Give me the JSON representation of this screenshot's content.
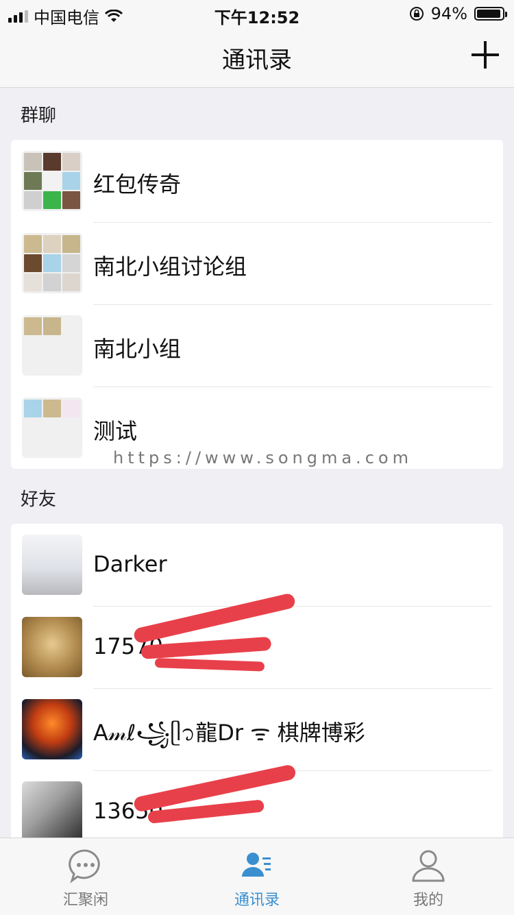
{
  "status_bar": {
    "carrier": "中国电信",
    "time": "下午12:52",
    "battery": "94%",
    "battery_level": 0.94
  },
  "nav": {
    "title": "通讯录"
  },
  "groups": {
    "header": "群聊",
    "items": [
      {
        "name": "红包传奇"
      },
      {
        "name": "南北小组讨论组"
      },
      {
        "name": "南北小组"
      },
      {
        "name": "测试"
      }
    ]
  },
  "watermark": "https://www.songma.com",
  "friends": {
    "header": "好友",
    "items": [
      {
        "name": "Darker"
      },
      {
        "name": "17570"
      },
      {
        "name": "A𝓂ℓ꧁ᥫ᭡龍Dr ᯤ  棋牌博彩"
      },
      {
        "name": "13650"
      }
    ]
  },
  "tabs": [
    {
      "label": "汇聚闲",
      "icon": "chat-bubble-icon",
      "active": false
    },
    {
      "label": "通讯录",
      "icon": "contacts-icon",
      "active": true
    },
    {
      "label": "我的",
      "icon": "profile-icon",
      "active": false
    }
  ],
  "colors": {
    "accent": "#3a8fd0",
    "background": "#efeff4",
    "redaction": "#e8404a"
  }
}
